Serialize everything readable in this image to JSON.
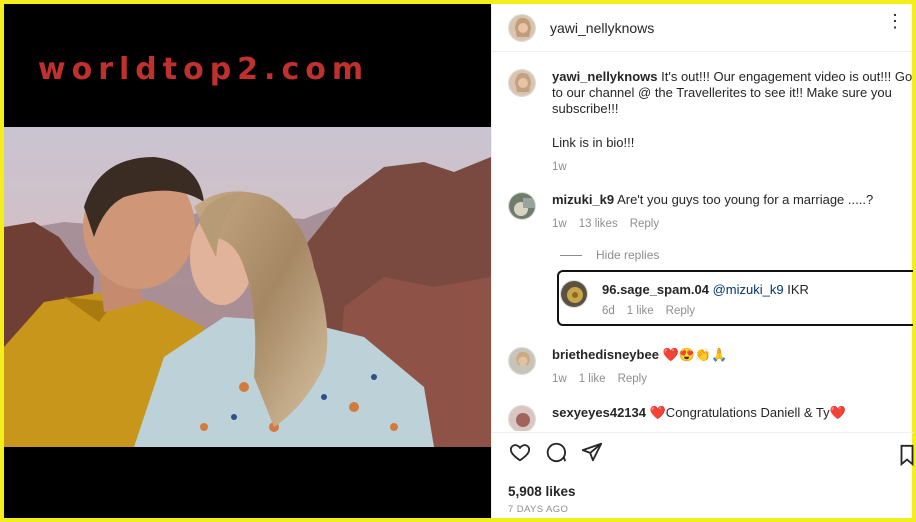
{
  "watermark": "worldtop2.com",
  "post": {
    "username": "yawi_nellyknows"
  },
  "comments": [
    {
      "username": "yawi_nellyknows",
      "text": "It's out!!! Our engagement video is out!!! Go to our channel @ the Travellerites to see it!! Make sure you subscribe!!!",
      "text2": "Link is in bio!!!",
      "time": "1w"
    },
    {
      "username": "mizuki_k9",
      "text": "Are't you guys too young for a marriage .....?",
      "time": "1w",
      "likes": "13 likes",
      "reply": "Reply"
    },
    {
      "username": "briethedisneybee",
      "text": "❤️😍👏🙏",
      "time": "1w",
      "likes": "1 like",
      "reply": "Reply"
    },
    {
      "username": "sexyeyes42134",
      "text": "❤️Congratulations Daniell & Ty❤️"
    }
  ],
  "hide_replies": "Hide replies",
  "reply": {
    "username": "96.sage_spam.04",
    "mention": "@mizuki_k9",
    "text": "IKR",
    "time": "6d",
    "likes": "1 like",
    "reply": "Reply"
  },
  "likes_count": "5,908 likes",
  "date": "7 DAYS AGO",
  "icons": {
    "like": "heart-icon",
    "comment": "comment-icon",
    "share": "share-icon",
    "save": "bookmark-icon",
    "more": "more-icon"
  },
  "colors": {
    "frame": "#f4ee1a",
    "watermark": "#c0302d",
    "heart": "#ed4956"
  }
}
